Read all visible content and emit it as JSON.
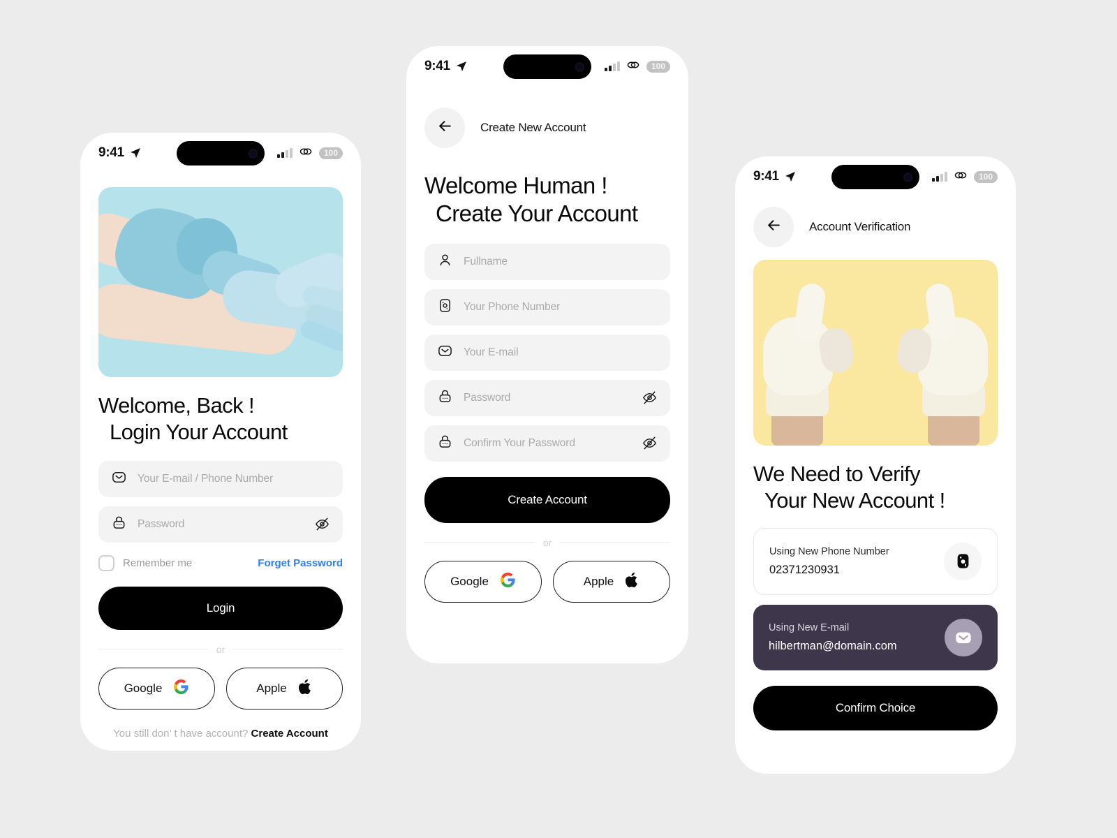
{
  "background_color": "#ececec",
  "status_bar": {
    "time": "9:41",
    "battery": "100",
    "icons": [
      "location-arrow-icon",
      "signal-bars-icon",
      "link-icon",
      "battery-icon"
    ]
  },
  "screens": {
    "login": {
      "hero_bg": "#b6e2ec",
      "hero_alt": "gloved-hands-putting-on-glove",
      "headline_line1": "Welcome, Back !",
      "headline_line2": "Login Your Account",
      "fields": [
        {
          "icon": "mail-icon",
          "placeholder": "Your E-mail / Phone Number",
          "value": "",
          "eye": false
        },
        {
          "icon": "lock-icon",
          "placeholder": "Password",
          "value": "",
          "eye": true
        }
      ],
      "remember_label": "Remember me",
      "forgot_label": "Forget Password",
      "primary_button": "Login",
      "divider": "or",
      "social": [
        {
          "label": "Google",
          "icon": "google-icon"
        },
        {
          "label": "Apple",
          "icon": "apple-icon"
        }
      ],
      "footer_text": "You still don’ t have account?",
      "footer_link": "Create Account"
    },
    "signup": {
      "nav_title": "Create New Account",
      "back_icon": "arrow-left-icon",
      "headline_line1": "Welcome Human !",
      "headline_line2": "Create Your Account",
      "fields": [
        {
          "icon": "user-icon",
          "placeholder": "Fullname",
          "value": "",
          "eye": false
        },
        {
          "icon": "sim-card-icon",
          "placeholder": "Your Phone Number",
          "value": "",
          "eye": false
        },
        {
          "icon": "mail-icon",
          "placeholder": "Your E-mail",
          "value": "",
          "eye": false
        },
        {
          "icon": "lock-icon",
          "placeholder": "Password",
          "value": "",
          "eye": true
        },
        {
          "icon": "lock-icon",
          "placeholder": "Confirm Your Password",
          "value": "",
          "eye": true
        }
      ],
      "primary_button": "Create Account",
      "divider": "or",
      "social": [
        {
          "label": "Google",
          "icon": "google-icon"
        },
        {
          "label": "Apple",
          "icon": "apple-icon"
        }
      ]
    },
    "verify": {
      "nav_title": "Account Verification",
      "back_icon": "arrow-left-icon",
      "hero_bg": "#fae8a0",
      "hero_alt": "two-gloved-thumbs-up",
      "headline_line1": "We Need to Verify",
      "headline_line2": "Your New Account !",
      "options": [
        {
          "label": "Using New Phone Number",
          "value": "02371230931",
          "icon": "sim-card-icon",
          "selected": false
        },
        {
          "label": "Using New E-mail",
          "value": "hilbertman@domain.com",
          "icon": "mail-icon",
          "selected": true,
          "selected_color": "#3e364a"
        }
      ],
      "primary_button": "Confirm Choice"
    }
  }
}
